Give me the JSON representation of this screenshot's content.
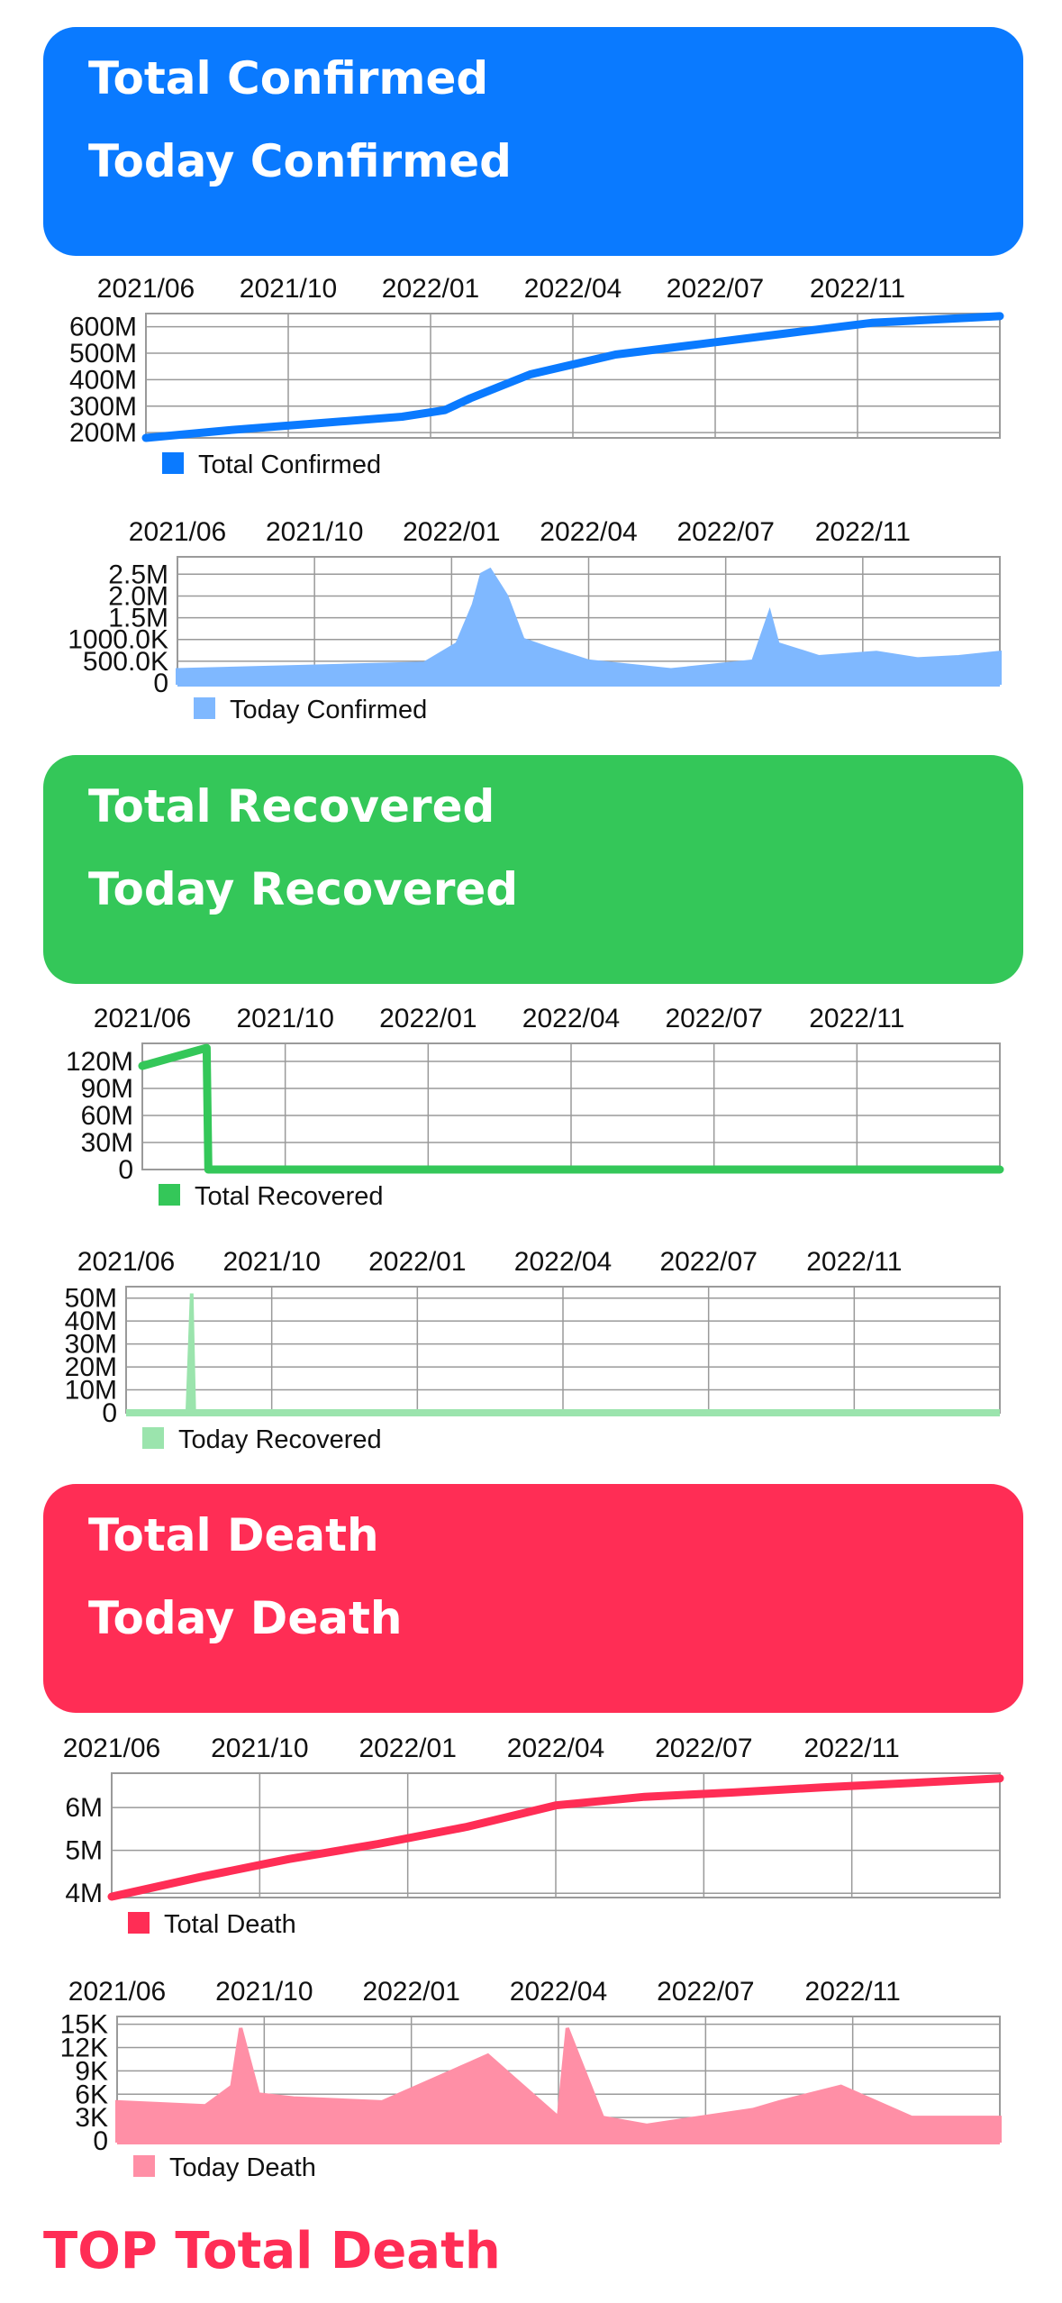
{
  "cards": [
    {
      "line1": "Total Confirmed",
      "line2": "Today Confirmed",
      "color": "#0a7aff"
    },
    {
      "line1": "Total Recovered",
      "line2": "Today Recovered",
      "color": "#34c759"
    },
    {
      "line1": "Total Death",
      "line2": "Today Death",
      "color": "#ff2d55"
    }
  ],
  "footer": {
    "title": "TOP Total Death"
  },
  "chart_data": [
    {
      "type": "line",
      "legend": "Total Confirmed",
      "color": "#0a7aff",
      "x_ticks": [
        "2021/06",
        "2021/10",
        "2022/01",
        "2022/04",
        "2022/07",
        "2022/11"
      ],
      "y_ticks": [
        "600M",
        "500M",
        "400M",
        "300M",
        "200M"
      ],
      "y_tick_values": [
        600,
        500,
        400,
        300,
        200
      ],
      "ylim": [
        180,
        650
      ],
      "unit": "M",
      "grid": true,
      "series": [
        {
          "x": [
            0,
            0.1,
            0.2,
            0.3,
            0.35,
            0.38,
            0.45,
            0.55,
            0.65,
            0.75,
            0.85,
            1.0
          ],
          "values": [
            180,
            210,
            235,
            260,
            285,
            330,
            420,
            495,
            535,
            575,
            615,
            640
          ]
        }
      ]
    },
    {
      "type": "bar",
      "legend": "Today Confirmed",
      "color": "#7fb8ff",
      "x_ticks": [
        "2021/06",
        "2021/10",
        "2022/01",
        "2022/04",
        "2022/07",
        "2022/11"
      ],
      "y_ticks": [
        "2.5M",
        "2.0M",
        "1.5M",
        "1000.0K",
        "500.0K",
        "0"
      ],
      "y_tick_values": [
        2500,
        2000,
        1500,
        1000,
        500,
        0
      ],
      "ylim": [
        0,
        2900
      ],
      "unit": "K",
      "grid": true,
      "series": [
        {
          "x": [
            0,
            0.2,
            0.3,
            0.34,
            0.36,
            0.37,
            0.38,
            0.39,
            0.4,
            0.42,
            0.45,
            0.5,
            0.6,
            0.7,
            0.72,
            0.73,
            0.78,
            0.85,
            0.9,
            0.95,
            1.0
          ],
          "values": [
            300,
            400,
            450,
            900,
            1800,
            2500,
            2600,
            2300,
            2000,
            1000,
            800,
            500,
            300,
            500,
            1600,
            900,
            600,
            700,
            550,
            600,
            700
          ]
        }
      ]
    },
    {
      "type": "line",
      "legend": "Total Recovered",
      "color": "#34c759",
      "x_ticks": [
        "2021/06",
        "2021/10",
        "2022/01",
        "2022/04",
        "2022/07",
        "2022/11"
      ],
      "y_ticks": [
        "120M",
        "90M",
        "60M",
        "30M",
        "0"
      ],
      "y_tick_values": [
        120,
        90,
        60,
        30,
        0
      ],
      "ylim": [
        0,
        140
      ],
      "unit": "M",
      "grid": true,
      "series": [
        {
          "x": [
            0,
            0.075,
            0.077,
            1.0
          ],
          "values": [
            115,
            135,
            0,
            0
          ]
        }
      ]
    },
    {
      "type": "bar",
      "legend": "Today Recovered",
      "color": "#9be4ad",
      "x_ticks": [
        "2021/06",
        "2021/10",
        "2022/01",
        "2022/04",
        "2022/07",
        "2022/11"
      ],
      "y_ticks": [
        "50M",
        "40M",
        "30M",
        "20M",
        "10M",
        "0"
      ],
      "y_tick_values": [
        50,
        40,
        30,
        20,
        10,
        0
      ],
      "ylim": [
        0,
        55
      ],
      "unit": "M",
      "grid": true,
      "series": [
        {
          "x": [
            0,
            0.07,
            0.075,
            0.078,
            1.0
          ],
          "values": [
            0,
            0,
            52,
            0,
            0
          ]
        }
      ]
    },
    {
      "type": "line",
      "legend": "Total Death",
      "color": "#ff2d55",
      "x_ticks": [
        "2021/06",
        "2021/10",
        "2022/01",
        "2022/04",
        "2022/07",
        "2022/11"
      ],
      "y_ticks": [
        "6M",
        "5M",
        "4M"
      ],
      "y_tick_values": [
        6,
        5,
        4
      ],
      "ylim": [
        3.9,
        6.8
      ],
      "unit": "M",
      "grid": true,
      "series": [
        {
          "x": [
            0,
            0.1,
            0.2,
            0.3,
            0.4,
            0.5,
            0.6,
            0.7,
            0.8,
            0.9,
            1.0
          ],
          "values": [
            3.92,
            4.38,
            4.8,
            5.15,
            5.55,
            6.05,
            6.25,
            6.35,
            6.47,
            6.57,
            6.68
          ]
        }
      ]
    },
    {
      "type": "bar",
      "legend": "Today Death",
      "color": "#ff8fa6",
      "x_ticks": [
        "2021/06",
        "2021/10",
        "2022/01",
        "2022/04",
        "2022/07",
        "2022/11"
      ],
      "y_ticks": [
        "15K",
        "12K",
        "9K",
        "6K",
        "3K",
        "0"
      ],
      "y_tick_values": [
        15,
        12,
        9,
        6,
        3,
        0
      ],
      "ylim": [
        0,
        16
      ],
      "unit": "K",
      "grid": true,
      "series": [
        {
          "x": [
            0,
            0.1,
            0.13,
            0.14,
            0.16,
            0.2,
            0.3,
            0.4,
            0.42,
            0.45,
            0.5,
            0.51,
            0.55,
            0.6,
            0.72,
            0.75,
            0.82,
            0.9,
            0.95,
            1.0
          ],
          "values": [
            5,
            4.5,
            7,
            14.5,
            6,
            5.5,
            5,
            10,
            11,
            8,
            3,
            14.5,
            3,
            2,
            4,
            5,
            7,
            3,
            3,
            3
          ]
        }
      ]
    }
  ]
}
